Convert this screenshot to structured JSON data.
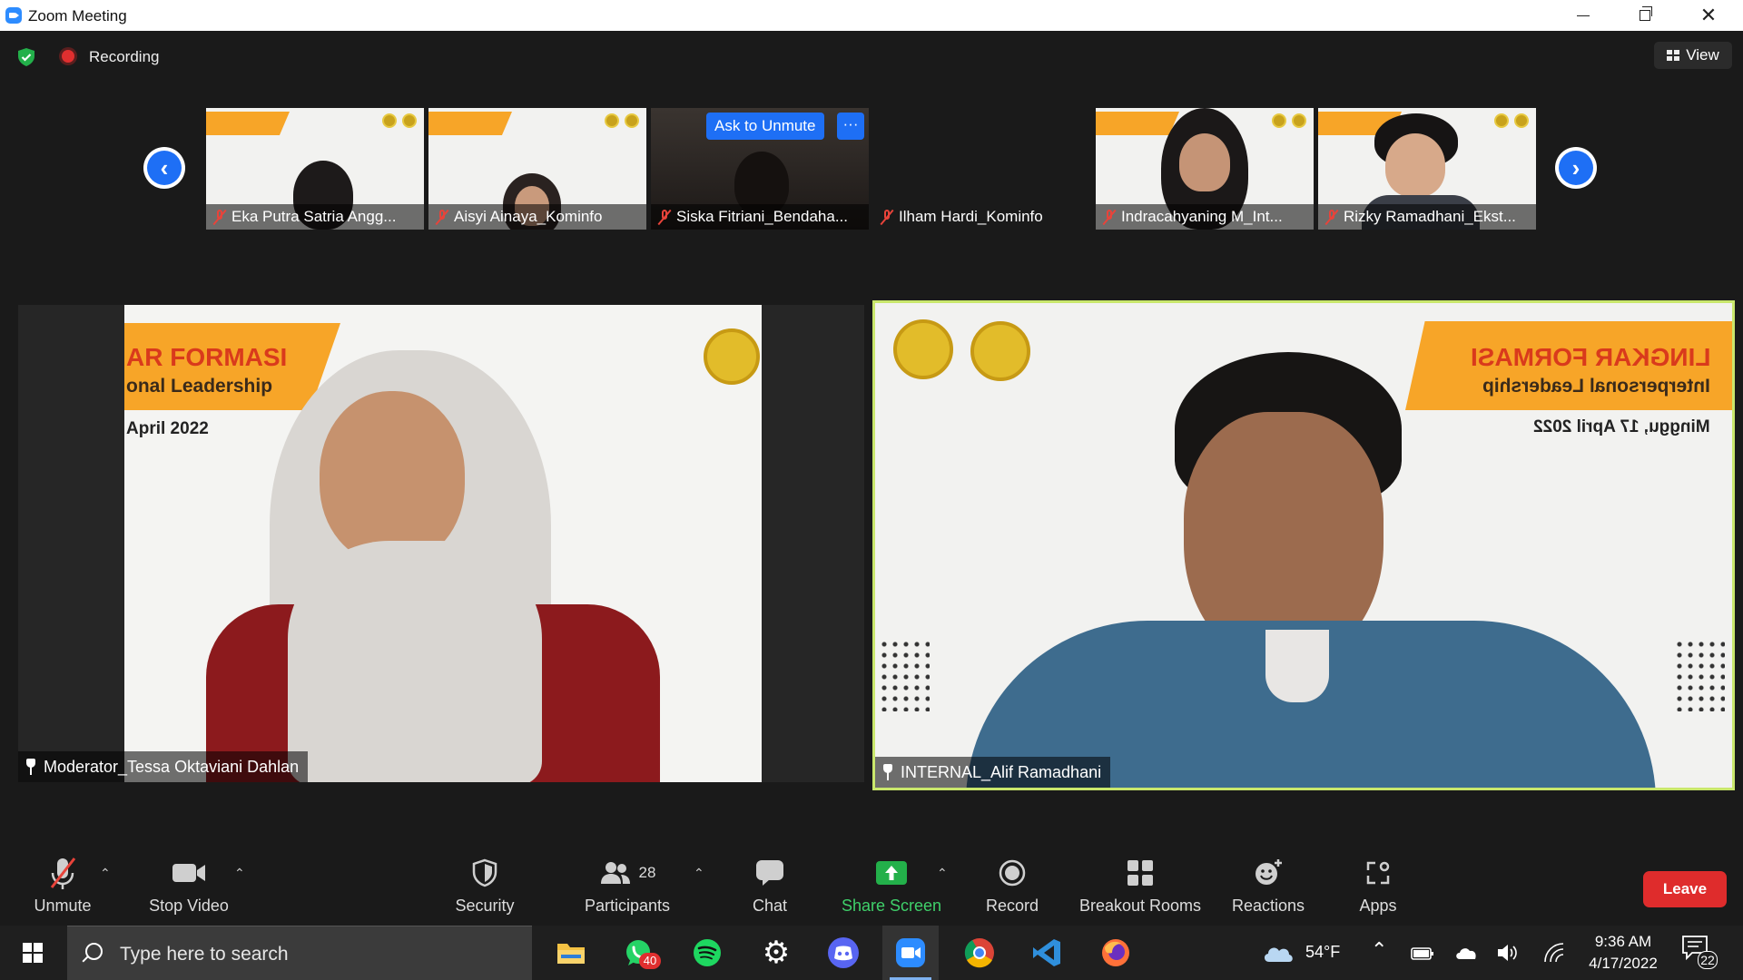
{
  "window": {
    "title": "Zoom Meeting"
  },
  "meeting_bar": {
    "recording_label": "Recording",
    "view_label": "View"
  },
  "gallery": {
    "ask_unmute_label": "Ask to Unmute",
    "more_label": "···",
    "participants": [
      {
        "name": "Eka Putra Satria Angg...",
        "feed": "poster"
      },
      {
        "name": "Aisyi Ainaya_Kominfo",
        "feed": "poster"
      },
      {
        "name": "Siska Fitriani_Bendaha...",
        "feed": "dark"
      },
      {
        "name": "Ilham Hardi_Kominfo",
        "feed": "none"
      },
      {
        "name": "Indracahyaning M_Int...",
        "feed": "poster"
      },
      {
        "name": "Rizky Ramadhani_Ekst...",
        "feed": "poster"
      }
    ]
  },
  "left_video": {
    "name": "Moderator_Tessa Oktaviani Dahlan",
    "slide_line1": "AR FORMASI",
    "slide_line2": "onal Leadership",
    "slide_line3": "April 2022"
  },
  "right_video": {
    "name": "INTERNAL_Alif Ramadhani",
    "slide_line1": "LINGKAR FORMASI",
    "slide_line2": "Interpersonal Leadership",
    "slide_line3": "Minggu, 17 April 2022"
  },
  "toolbar": {
    "unmute": "Unmute",
    "stop_video": "Stop Video",
    "security": "Security",
    "participants": "Participants",
    "participants_count": "28",
    "chat": "Chat",
    "share_screen": "Share Screen",
    "record": "Record",
    "breakout_rooms": "Breakout Rooms",
    "reactions": "Reactions",
    "apps": "Apps",
    "leave": "Leave"
  },
  "taskbar": {
    "search_placeholder": "Type here to search",
    "whatsapp_badge": "40",
    "weather": "54°F",
    "time": "9:36 AM",
    "date": "4/17/2022",
    "notifications": "22"
  },
  "colors": {
    "zoom_blue": "#1e6ff5",
    "leave_red": "#df2c2c",
    "share_green": "#23b04a",
    "active_speaker_border": "#c9e76c",
    "slide_orange": "#f7a528"
  }
}
